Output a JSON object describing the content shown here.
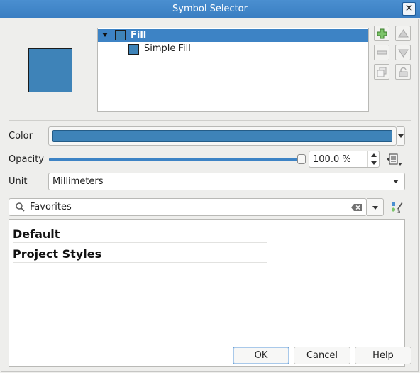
{
  "window": {
    "title": "Symbol Selector",
    "close_glyph": "✕"
  },
  "symbol_tree": {
    "items": [
      {
        "label": "Fill",
        "selected": true,
        "expanded": true
      },
      {
        "label": "Simple Fill",
        "selected": false
      }
    ]
  },
  "layer_buttons": [
    {
      "icon": "add-layer-icon",
      "enabled": true
    },
    {
      "icon": "remove-layer-icon",
      "enabled": false
    },
    {
      "icon": "duplicate-layer-icon",
      "enabled": false
    },
    {
      "icon": "move-up-icon",
      "enabled": false
    },
    {
      "icon": "move-down-icon",
      "enabled": false
    },
    {
      "icon": "lock-layer-icon",
      "enabled": false
    }
  ],
  "properties": {
    "color_label": "Color",
    "color_value": "#3e83b8",
    "opacity_label": "Opacity",
    "opacity_value": "100.0 %",
    "opacity_fraction": 1.0,
    "unit_label": "Unit",
    "unit_value": "Millimeters"
  },
  "search": {
    "value": "Favorites"
  },
  "library": {
    "groups": [
      "Default",
      "Project Styles"
    ]
  },
  "buttons": {
    "ok": "OK",
    "cancel": "Cancel",
    "help": "Help"
  },
  "colors": {
    "accent": "#3d83c5",
    "symbol_fill": "#3e83b8",
    "titlebar": "#3a7ec2"
  }
}
